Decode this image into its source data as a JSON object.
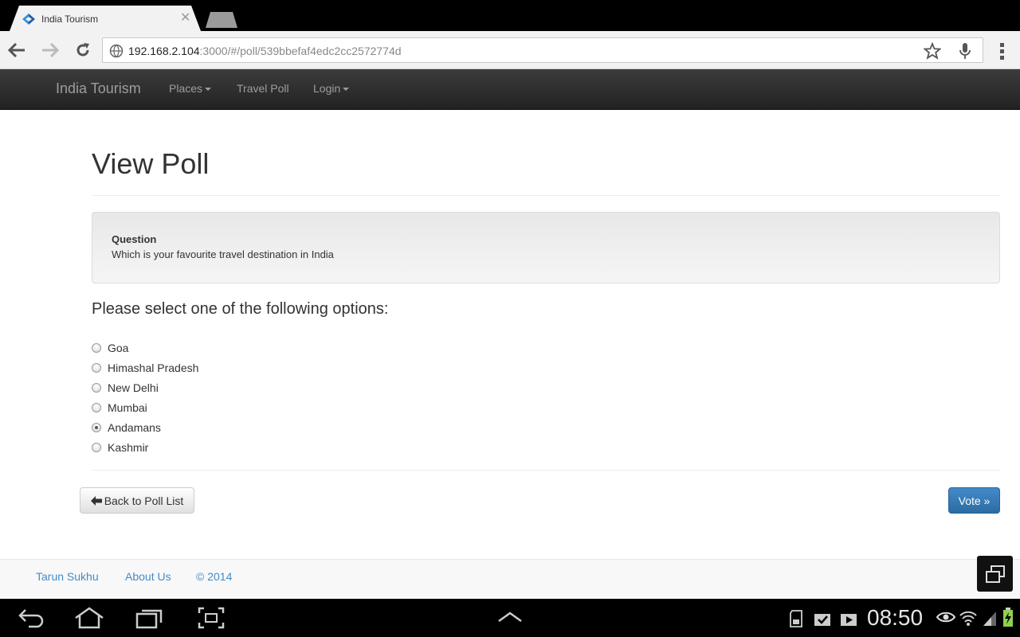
{
  "browser": {
    "tab_title": "India Tourism",
    "url_host": "192.168.2.104",
    "url_rest": ":3000/#/poll/539bbefaf4edc2cc2572774d"
  },
  "navbar": {
    "brand": "India Tourism",
    "links": [
      "Places",
      "Travel Poll",
      "Login"
    ]
  },
  "main": {
    "title": "View Poll",
    "question_label": "Question",
    "question_text": "Which is your favourite travel destination in India",
    "prompt": "Please select one of the following options:",
    "options": [
      "Goa",
      "Himashal Pradesh",
      "New Delhi",
      "Mumbai",
      "Andamans",
      "Kashmir"
    ],
    "selected_option": "Andamans",
    "back_label": "Back to Poll List",
    "vote_label": "Vote »"
  },
  "footer": {
    "links": [
      "Tarun Sukhu",
      "About Us",
      "© 2014"
    ]
  },
  "system": {
    "time": "08:50"
  },
  "colors": {
    "accent": "#428bca",
    "navbar": "#222222"
  }
}
